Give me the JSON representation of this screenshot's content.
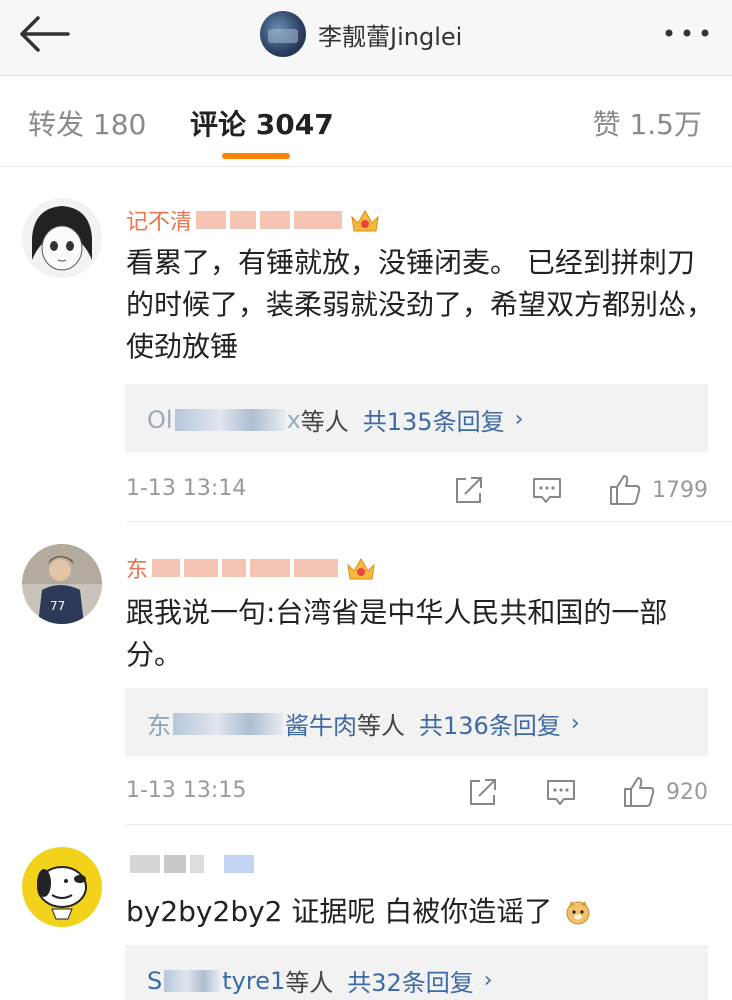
{
  "header": {
    "title": "李靓蕾Jinglei",
    "back_icon": "back-arrow-icon",
    "more_icon": "more-dots-icon"
  },
  "tabs": {
    "repost": "转发 180",
    "comment": "评论 3047",
    "like": "赞 1.5万",
    "active_color": "#ff8200"
  },
  "comments": [
    {
      "name_visible": "记不清",
      "text": "看累了，有锤就放，没锤闭麦。 已经到拼刺刀的时候了，装柔弱就没劲了，希望双方都别怂，使劲放锤",
      "reply_prefix": "Ol",
      "reply_suffix": "x",
      "reply_text": "等人",
      "reply_count": "共135条回复",
      "time": "1-13 13:14",
      "likes": "1799",
      "badge_level": "3"
    },
    {
      "name_visible": "东",
      "text": "跟我说一句:台湾省是中华人民共和国的一部分。",
      "reply_prefix": "东",
      "reply_suffix": "酱牛肉",
      "reply_text": "等人",
      "reply_count": "共136条回复",
      "time": "1-13 13:15",
      "likes": "920",
      "badge_level": "5"
    },
    {
      "name_visible": "",
      "text": "by2by2by2 证据呢 白被你造谣了",
      "reply_prefix": "S",
      "reply_suffix": "tyre1",
      "reply_text": "等人",
      "reply_count": "共32条回复"
    }
  ],
  "colors": {
    "username": "#eb7350",
    "link": "#3d6aa5",
    "reply_bg": "#f2f2f2"
  }
}
